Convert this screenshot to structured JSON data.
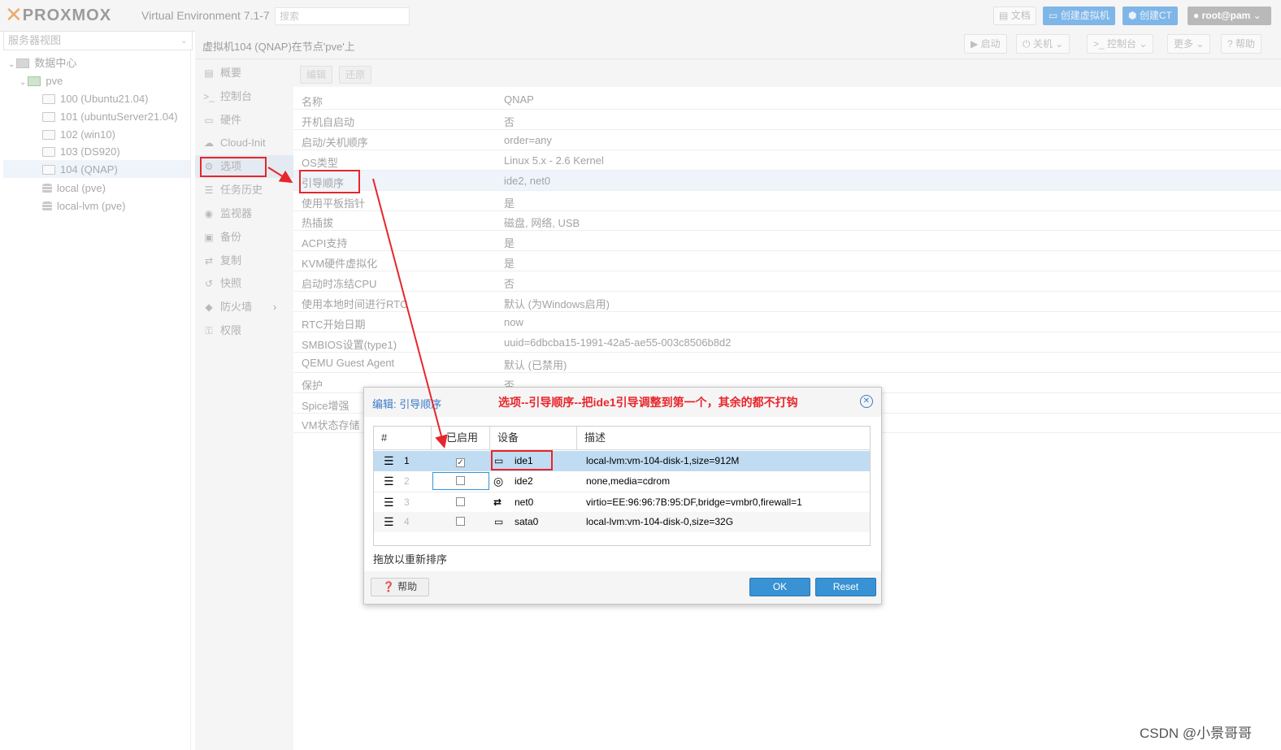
{
  "header": {
    "logo_text": "PROXMOX",
    "version": "Virtual Environment 7.1-7",
    "search_placeholder": "搜索",
    "docs": "文档",
    "create_vm": "创建虚拟机",
    "create_ct": "创建CT",
    "user": "root@pam"
  },
  "tree": {
    "view": "服务器视图",
    "datacenter": "数据中心",
    "node": "pve",
    "vms": [
      "100 (Ubuntu21.04)",
      "101 (ubuntuServer21.04)",
      "102 (win10)",
      "103 (DS920)",
      "104 (QNAP)"
    ],
    "storages": [
      "local (pve)",
      "local-lvm (pve)"
    ]
  },
  "vm_header": {
    "title": "虚拟机104 (QNAP)在节点'pve'上",
    "start": "启动",
    "shutdown": "关机",
    "console": "控制台",
    "more": "更多",
    "help": "帮助"
  },
  "menu": {
    "items": [
      "概要",
      "控制台",
      "硬件",
      "Cloud-Init",
      "选项",
      "任务历史",
      "监视器",
      "备份",
      "复制",
      "快照",
      "防火墙",
      "权限"
    ]
  },
  "options": {
    "edit": "编辑",
    "revert": "还原",
    "rows": [
      {
        "k": "名称",
        "v": "QNAP"
      },
      {
        "k": "开机自启动",
        "v": "否"
      },
      {
        "k": "启动/关机顺序",
        "v": "order=any"
      },
      {
        "k": "OS类型",
        "v": "Linux 5.x - 2.6 Kernel"
      },
      {
        "k": "引导顺序",
        "v": "ide2, net0"
      },
      {
        "k": "使用平板指针",
        "v": "是"
      },
      {
        "k": "热插拔",
        "v": "磁盘, 网络, USB"
      },
      {
        "k": "ACPI支持",
        "v": "是"
      },
      {
        "k": "KVM硬件虚拟化",
        "v": "是"
      },
      {
        "k": "启动时冻结CPU",
        "v": "否"
      },
      {
        "k": "使用本地时间进行RTC",
        "v": "默认 (为Windows启用)"
      },
      {
        "k": "RTC开始日期",
        "v": "now"
      },
      {
        "k": "SMBIOS设置(type1)",
        "v": "uuid=6dbcba15-1991-42a5-ae55-003c8506b8d2"
      },
      {
        "k": "QEMU Guest Agent",
        "v": "默认 (已禁用)"
      },
      {
        "k": "保护",
        "v": "否"
      },
      {
        "k": "Spice增强",
        "v": ""
      },
      {
        "k": "VM状态存储",
        "v": ""
      }
    ]
  },
  "dialog": {
    "title": "编辑: 引导顺序",
    "annotation": "选项--引导顺序--把ide1引导调整到第一个，其余的都不打钩",
    "columns": [
      "#",
      "已启用",
      "设备",
      "描述"
    ],
    "rows": [
      {
        "num": "1",
        "enabled": "✓",
        "device": "ide1",
        "icon": "hdd-icon",
        "desc": "local-lvm:vm-104-disk-1,size=912M"
      },
      {
        "num": "2",
        "enabled": "",
        "device": "ide2",
        "icon": "cdrom-icon",
        "desc": "none,media=cdrom"
      },
      {
        "num": "3",
        "enabled": "",
        "device": "net0",
        "icon": "network-icon",
        "desc": "virtio=EE:96:96:7B:95:DF,bridge=vmbr0,firewall=1"
      },
      {
        "num": "4",
        "enabled": "",
        "device": "sata0",
        "icon": "hdd-icon",
        "desc": "local-lvm:vm-104-disk-0,size=32G"
      }
    ],
    "hint": "拖放以重新排序",
    "help": "帮助",
    "ok": "OK",
    "reset": "Reset"
  },
  "watermark": "CSDN @小景哥哥",
  "colors": {
    "accent": "#3892d4",
    "annotation_red": "#e8252b",
    "selection": "#c0dcf3"
  }
}
